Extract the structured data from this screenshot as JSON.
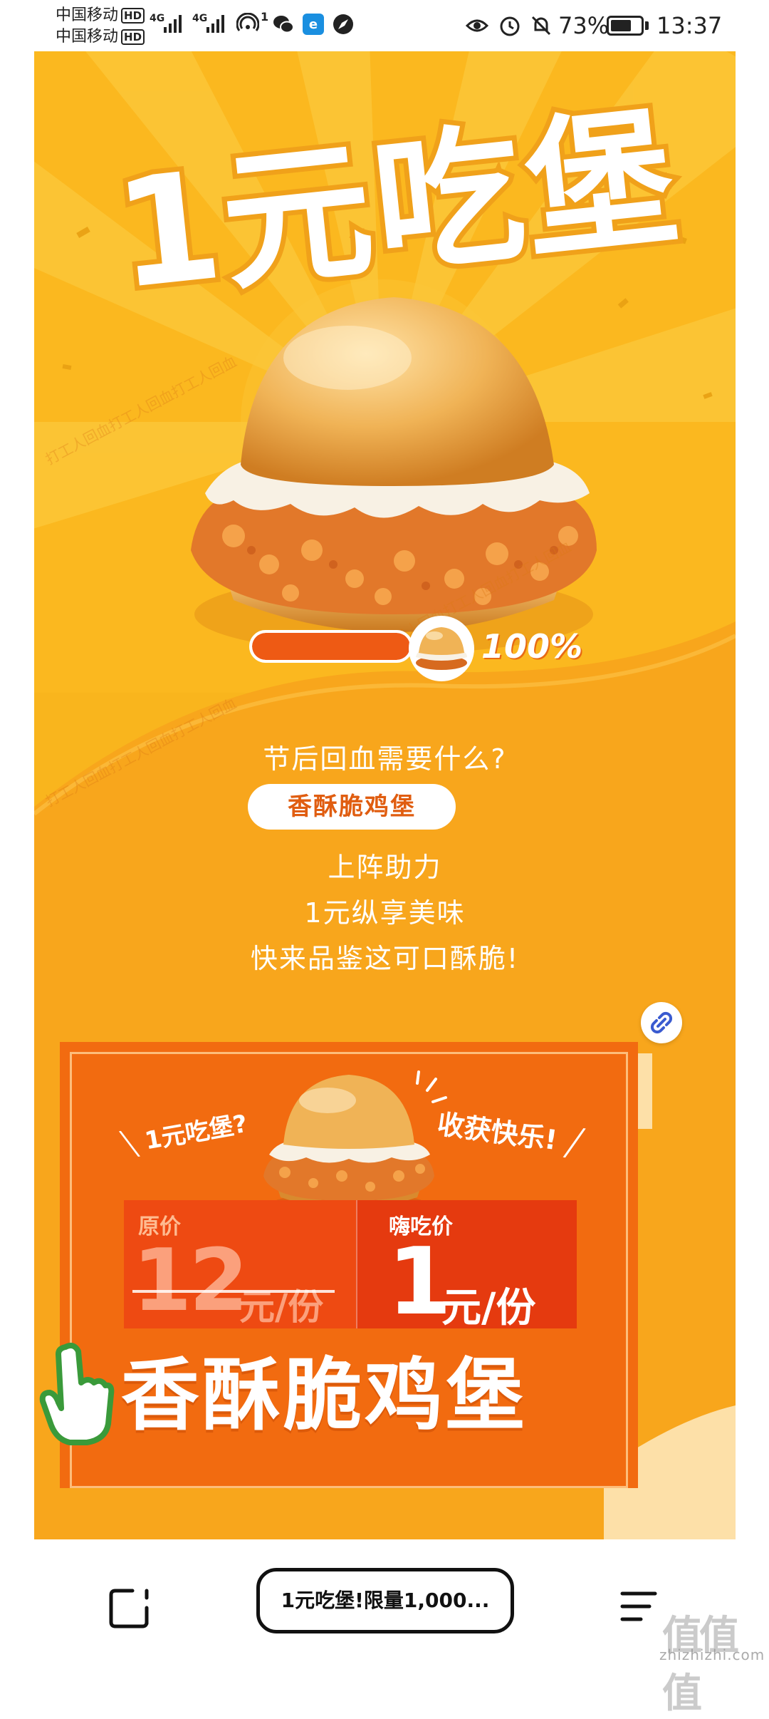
{
  "status_bar": {
    "carrier_1": "中国移动",
    "carrier_2": "中国移动",
    "hd": "HD",
    "network_1": "4G",
    "network_2": "4G",
    "hotspot_count": "1",
    "battery_pct": "73%",
    "battery_level": 0.73,
    "time": "13:37",
    "icons": [
      "signal-icon",
      "hotspot-icon",
      "wechat-icon",
      "browser-app-icon",
      "safari-icon",
      "eye-icon",
      "alarm-icon",
      "mute-icon",
      "battery-icon"
    ]
  },
  "hero": {
    "title": "1元吃堡",
    "colors": {
      "background": "#f9b51d",
      "title_fill": "#ffffff",
      "title_outline": "#f0a11a"
    }
  },
  "progress": {
    "value": 1.0,
    "label": "100%",
    "fill_color": "#ee5a14"
  },
  "watermark_text": "打工人回血打工人回血打工人回血",
  "copy": {
    "line_1": "节后回血需要什么?",
    "highlight": "香酥脆鸡堡",
    "line_2": "上阵助力",
    "line_3": "1元纵享美味",
    "line_4": "快来品鉴这可口酥脆!"
  },
  "panel": {
    "tag_left": "1元吃堡?",
    "tag_right": "收获快乐!",
    "original_label": "原价",
    "original_price": "12",
    "original_unit": "元/份",
    "deal_label": "嗨吃价",
    "deal_price": "1",
    "deal_unit": "元/份",
    "product_name": "香酥脆鸡堡",
    "colors": {
      "panel": "#f26b10",
      "price_left": "#ee4a12",
      "price_right": "#e53a0f",
      "hand": "#3a9a3a"
    }
  },
  "bottom_bar": {
    "url_title": "1元吃堡!限量1,000...",
    "site_mark": "值值值",
    "site_url": "zhizhizhi.com"
  }
}
